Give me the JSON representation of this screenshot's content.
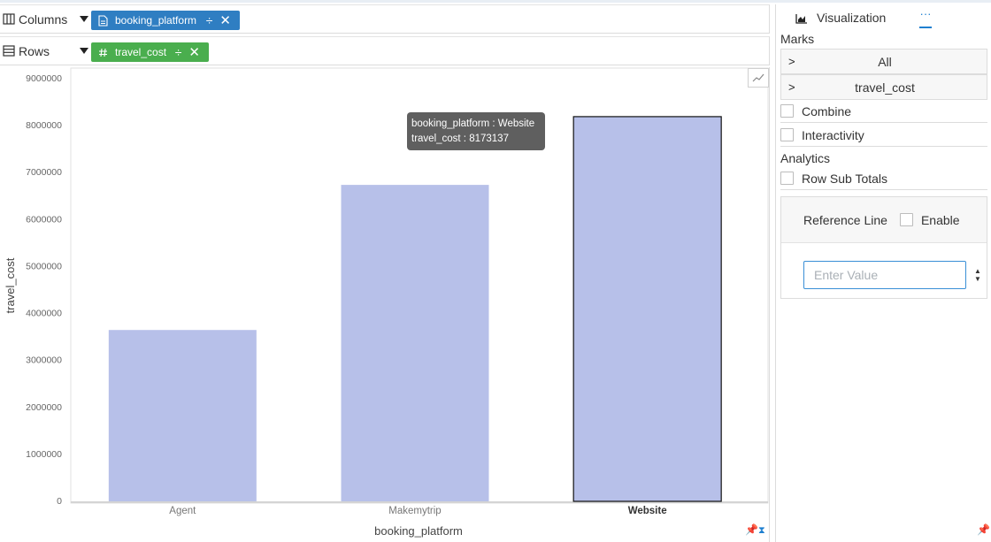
{
  "shelves": {
    "columns": {
      "label": "Columns",
      "pill": "booking_platform",
      "pill_op": "÷",
      "pill_color": "#2f7ec2"
    },
    "rows": {
      "label": "Rows",
      "pill": "travel_cost",
      "pill_op": "÷",
      "pill_color": "#4aae4e"
    }
  },
  "tooltip": {
    "line1": "booking_platform : Website",
    "line2": "travel_cost : 8173137"
  },
  "chart_data": {
    "type": "bar",
    "categories": [
      "Agent",
      "Makemytrip",
      "Website"
    ],
    "values": [
      3630000,
      6720000,
      8173137
    ],
    "selected": "Website",
    "xlabel": "booking_platform",
    "ylabel": "travel_cost",
    "ylim": [
      0,
      9000000
    ],
    "yticks": [
      "0",
      "1000000",
      "2000000",
      "3000000",
      "4000000",
      "5000000",
      "6000000",
      "7000000",
      "8000000",
      "9000000"
    ],
    "bar_color": "#b7c0e9",
    "grid": false
  },
  "side": {
    "tab_visualization": "Visualization",
    "tab_more": "···",
    "marks_heading": "Marks",
    "marks_items": [
      "All",
      "travel_cost"
    ],
    "combine": "Combine",
    "interactivity": "Interactivity",
    "analytics_heading": "Analytics",
    "row_sub_totals": "Row Sub Totals",
    "reference_line": "Reference Line",
    "enable": "Enable",
    "value_placeholder": "Enter Value"
  },
  "icons": {
    "columns": "columns-grid-icon",
    "rows": "rows-grid-icon",
    "dimension": "document-icon",
    "measure": "hash-icon",
    "trend": "trend-line-icon",
    "visualization": "area-chart-icon",
    "pin": "pin-icon"
  }
}
